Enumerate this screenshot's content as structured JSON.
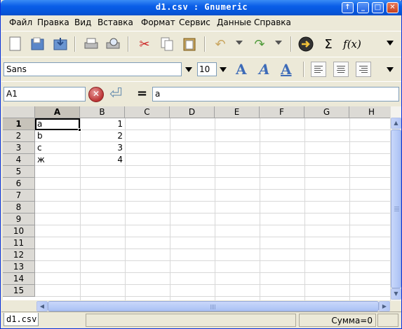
{
  "window": {
    "title": "d1.csv : Gnumeric"
  },
  "menu": {
    "items": [
      "Файл",
      "Правка",
      "Вид",
      "Вставка",
      "Формат",
      "Сервис",
      "Данные",
      "Справка"
    ]
  },
  "toolbar": {
    "icons": [
      "new-document-icon",
      "open-icon",
      "save-icon",
      "print-icon",
      "print-preview-icon",
      "cut-icon",
      "copy-icon",
      "paste-icon",
      "undo-icon",
      "redo-icon",
      "goto-icon",
      "sum-icon",
      "function-icon"
    ],
    "sum_symbol": "Σ",
    "function_symbol": "f(x)"
  },
  "format": {
    "font_name": "Sans",
    "font_size": "10",
    "style_letter": "A"
  },
  "formula": {
    "cell_ref": "A1",
    "equal": "=",
    "content": "a"
  },
  "grid": {
    "columns": [
      "A",
      "B",
      "C",
      "D",
      "E",
      "F",
      "G",
      "H"
    ],
    "rows": [
      "1",
      "2",
      "3",
      "4",
      "5",
      "6",
      "7",
      "8",
      "9",
      "10",
      "11",
      "12",
      "13",
      "14",
      "15"
    ],
    "active_cell": "A1",
    "cells": [
      {
        "a": "a",
        "b": "1"
      },
      {
        "a": "b",
        "b": "2"
      },
      {
        "a": "c",
        "b": "3"
      },
      {
        "a": "ж",
        "b": "4"
      }
    ]
  },
  "status": {
    "sheet_tab": "d1.csv",
    "sum": "Сумма=0"
  }
}
